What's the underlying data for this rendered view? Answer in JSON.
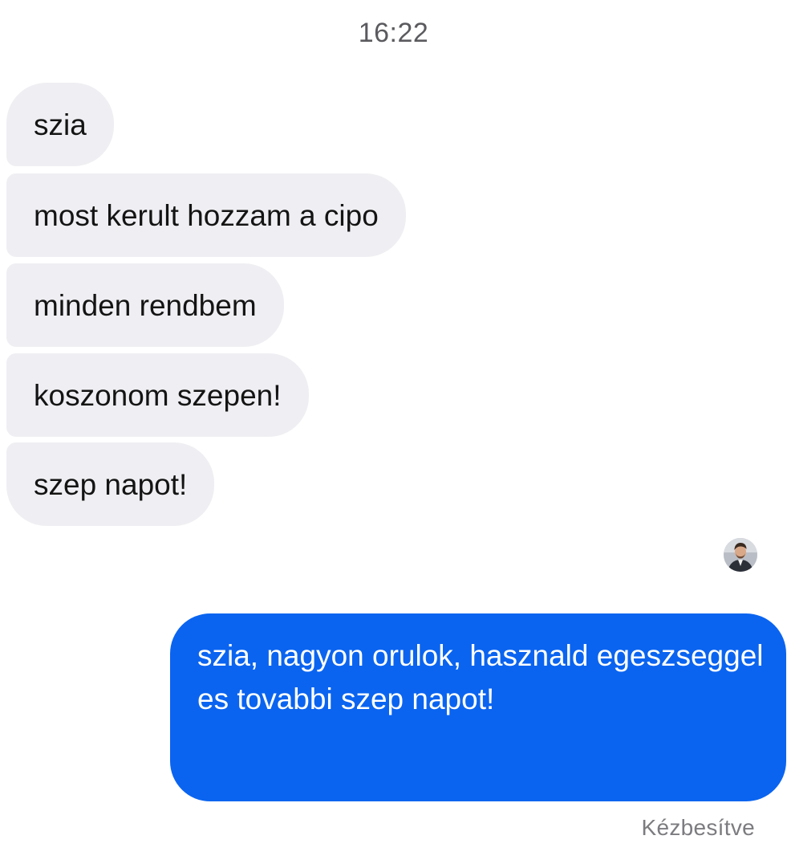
{
  "conversation": {
    "timestamp": "16:22",
    "incoming_messages": [
      "szia",
      "most kerult hozzam a cipo",
      "minden rendbem",
      "koszonom szepen!",
      "szep napot!"
    ],
    "outgoing_message": "szia, nagyon orulok, hasznald egeszseggel es tovabbi szep napot!",
    "status": "Kézbesítve",
    "read_receipt_icon": "profile-photo-avatar"
  },
  "colors": {
    "incoming_bubble": "#efeff3",
    "outgoing_bubble": "#0a64f0",
    "background": "#ffffff"
  }
}
